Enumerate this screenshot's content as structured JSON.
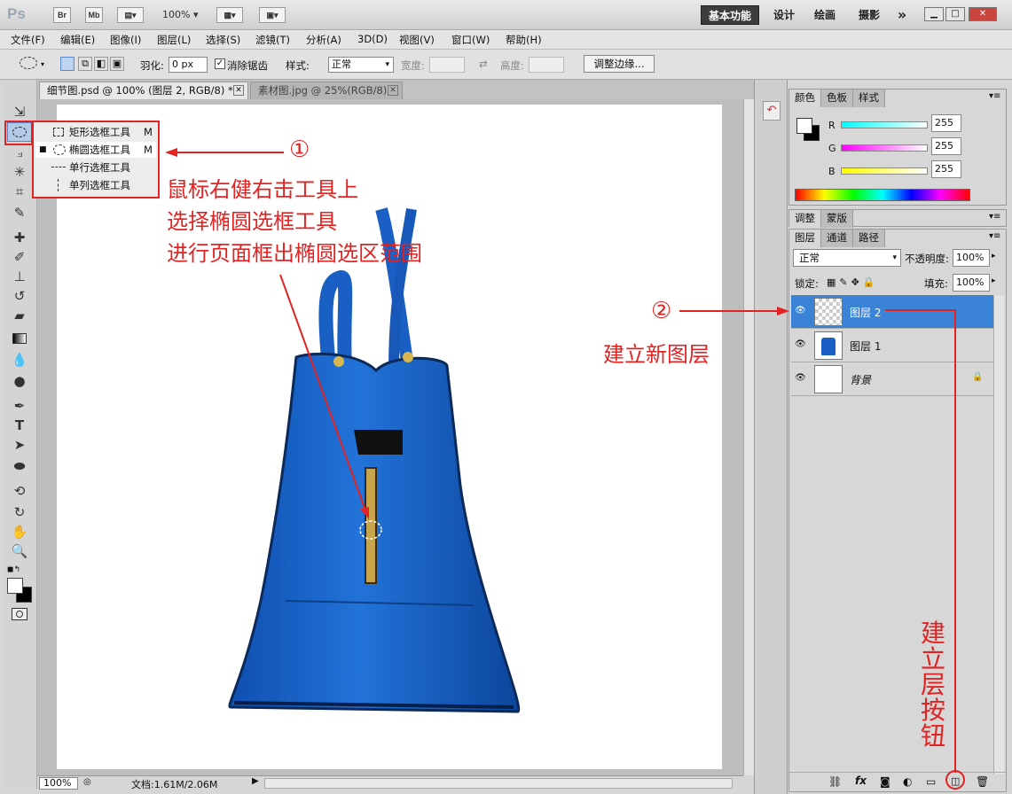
{
  "titlebar": {
    "logo": "Ps",
    "buttons": [
      "Br",
      "Mb"
    ],
    "zoom": "100%",
    "workspaces": [
      "基本功能",
      "设计",
      "绘画",
      "摄影"
    ],
    "more": "»"
  },
  "menu": [
    "文件(F)",
    "编辑(E)",
    "图像(I)",
    "图层(L)",
    "选择(S)",
    "滤镜(T)",
    "分析(A)",
    "3D(D)",
    "视图(V)",
    "窗口(W)",
    "帮助(H)"
  ],
  "options": {
    "feather_label": "羽化:",
    "feather_value": "0 px",
    "antialias_label": "消除锯齿",
    "style_label": "样式:",
    "style_value": "正常",
    "width_label": "宽度:",
    "height_label": "高度:",
    "refine_button": "调整边缘..."
  },
  "tabs": [
    {
      "label": "细节图.psd @ 100% (图层 2, RGB/8) *",
      "active": true
    },
    {
      "label": "素材图.jpg @ 25%(RGB/8)",
      "active": false
    }
  ],
  "tool_flyout": [
    {
      "label": "矩形选框工具",
      "shortcut": "M"
    },
    {
      "label": "椭圆选框工具",
      "shortcut": "M"
    },
    {
      "label": "单行选框工具",
      "shortcut": ""
    },
    {
      "label": "单列选框工具",
      "shortcut": ""
    }
  ],
  "statusbar": {
    "zoom": "100%",
    "doc": "文档:1.61M/2.06M"
  },
  "color_panel": {
    "tabs": [
      "颜色",
      "色板",
      "样式"
    ],
    "r_label": "R",
    "g_label": "G",
    "b_label": "B",
    "r": "255",
    "g": "255",
    "b": "255"
  },
  "adjust_panel": {
    "tabs": [
      "调整",
      "蒙版"
    ]
  },
  "layers_panel": {
    "tabs": [
      "图层",
      "通道",
      "路径"
    ],
    "blend_mode": "正常",
    "opacity_label": "不透明度:",
    "opacity": "100%",
    "lock_label": "锁定:",
    "fill_label": "填充:",
    "fill": "100%",
    "layers": [
      {
        "name": "图层 2",
        "selected": true
      },
      {
        "name": "图层 1",
        "selected": false
      },
      {
        "name": "背景",
        "selected": false
      }
    ]
  },
  "annotations": {
    "step1_marker": "①",
    "step1_lines": [
      "鼠标右健右击工具上",
      "选择椭圆选框工具",
      "进行页面框出椭圆选区范围"
    ],
    "step2_marker": "②",
    "step2_text": "建立新图层",
    "button_note": [
      "建",
      "立",
      "层",
      "按",
      "钮"
    ]
  },
  "colors": {
    "accent": "#3a83d6",
    "annotation": "#e32222",
    "bag": "#1a5fc4"
  }
}
